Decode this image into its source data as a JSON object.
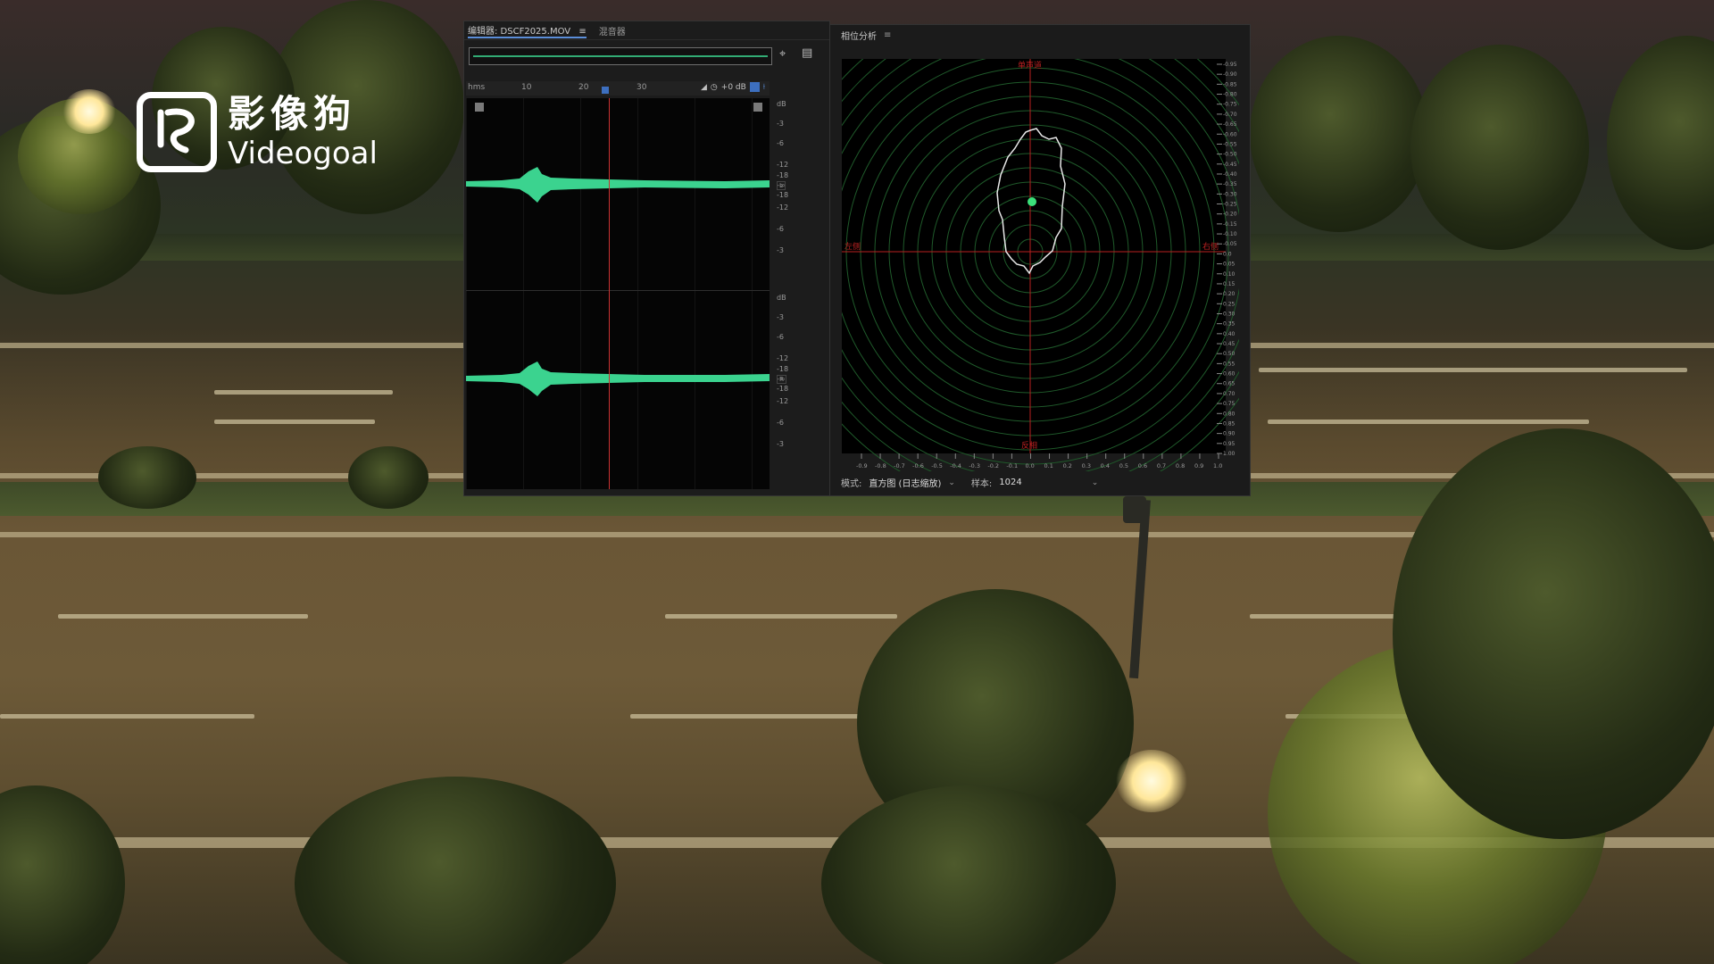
{
  "logo": {
    "cn_text": "影像狗",
    "en_text": "Videogoal"
  },
  "editor": {
    "tabs": [
      {
        "label": "编辑器: DSCF2025.MOV",
        "active": true
      },
      {
        "label": "混音器",
        "active": false
      }
    ],
    "tab_menu_icon": "≡",
    "ruler": {
      "unit": "hms",
      "ticks": [
        "10",
        "20",
        "30"
      ],
      "gain_label": "+0 dB"
    },
    "channels": [
      {
        "name": "L",
        "db_scale": [
          "dB",
          "-3",
          "-6",
          "-12",
          "-18",
          "-∞",
          "-18",
          "-12",
          "-6",
          "-3"
        ]
      },
      {
        "name": "R",
        "db_scale": [
          "dB",
          "-3",
          "-6",
          "-12",
          "-18",
          "-∞",
          "-18",
          "-12",
          "-6",
          "-3"
        ]
      }
    ]
  },
  "phase": {
    "title": "相位分析",
    "menu_icon": "≡",
    "labels": {
      "top": "单声道",
      "left": "左侧",
      "right": "右侧",
      "bottom": "反相"
    },
    "right_scale": [
      "-0.95",
      "-0.90",
      "-0.85",
      "-0.80",
      "-0.75",
      "-0.70",
      "-0.65",
      "-0.60",
      "-0.55",
      "-0.50",
      "-0.45",
      "-0.40",
      "-0.35",
      "-0.30",
      "-0.25",
      "-0.20",
      "-0.15",
      "-0.10",
      "-0.05",
      "0.0",
      "0.05",
      "0.10",
      "0.15",
      "0.20",
      "0.25",
      "0.30",
      "0.35",
      "0.40",
      "0.45",
      "0.50",
      "0.55",
      "0.60",
      "0.65",
      "0.70",
      "0.75",
      "0.80",
      "0.85",
      "0.90",
      "0.95",
      "1.00"
    ],
    "bottom_scale": [
      "-0.9",
      "-0.8",
      "-0.7",
      "-0.6",
      "-0.5",
      "-0.4",
      "-0.3",
      "-0.2",
      "-0.1",
      "0.0",
      "0.1",
      "0.2",
      "0.3",
      "0.4",
      "0.5",
      "0.6",
      "0.7",
      "0.8",
      "0.9",
      "1.0"
    ],
    "mode_label": "模式:",
    "mode_value": "直方图 (日志缩放)",
    "sample_label": "样本:",
    "sample_value": "1024"
  },
  "colors": {
    "waveform": "#3bd38f",
    "phase_grid": "#1f5a2a",
    "crosshair": "#b82020",
    "dot": "#3be07a"
  }
}
